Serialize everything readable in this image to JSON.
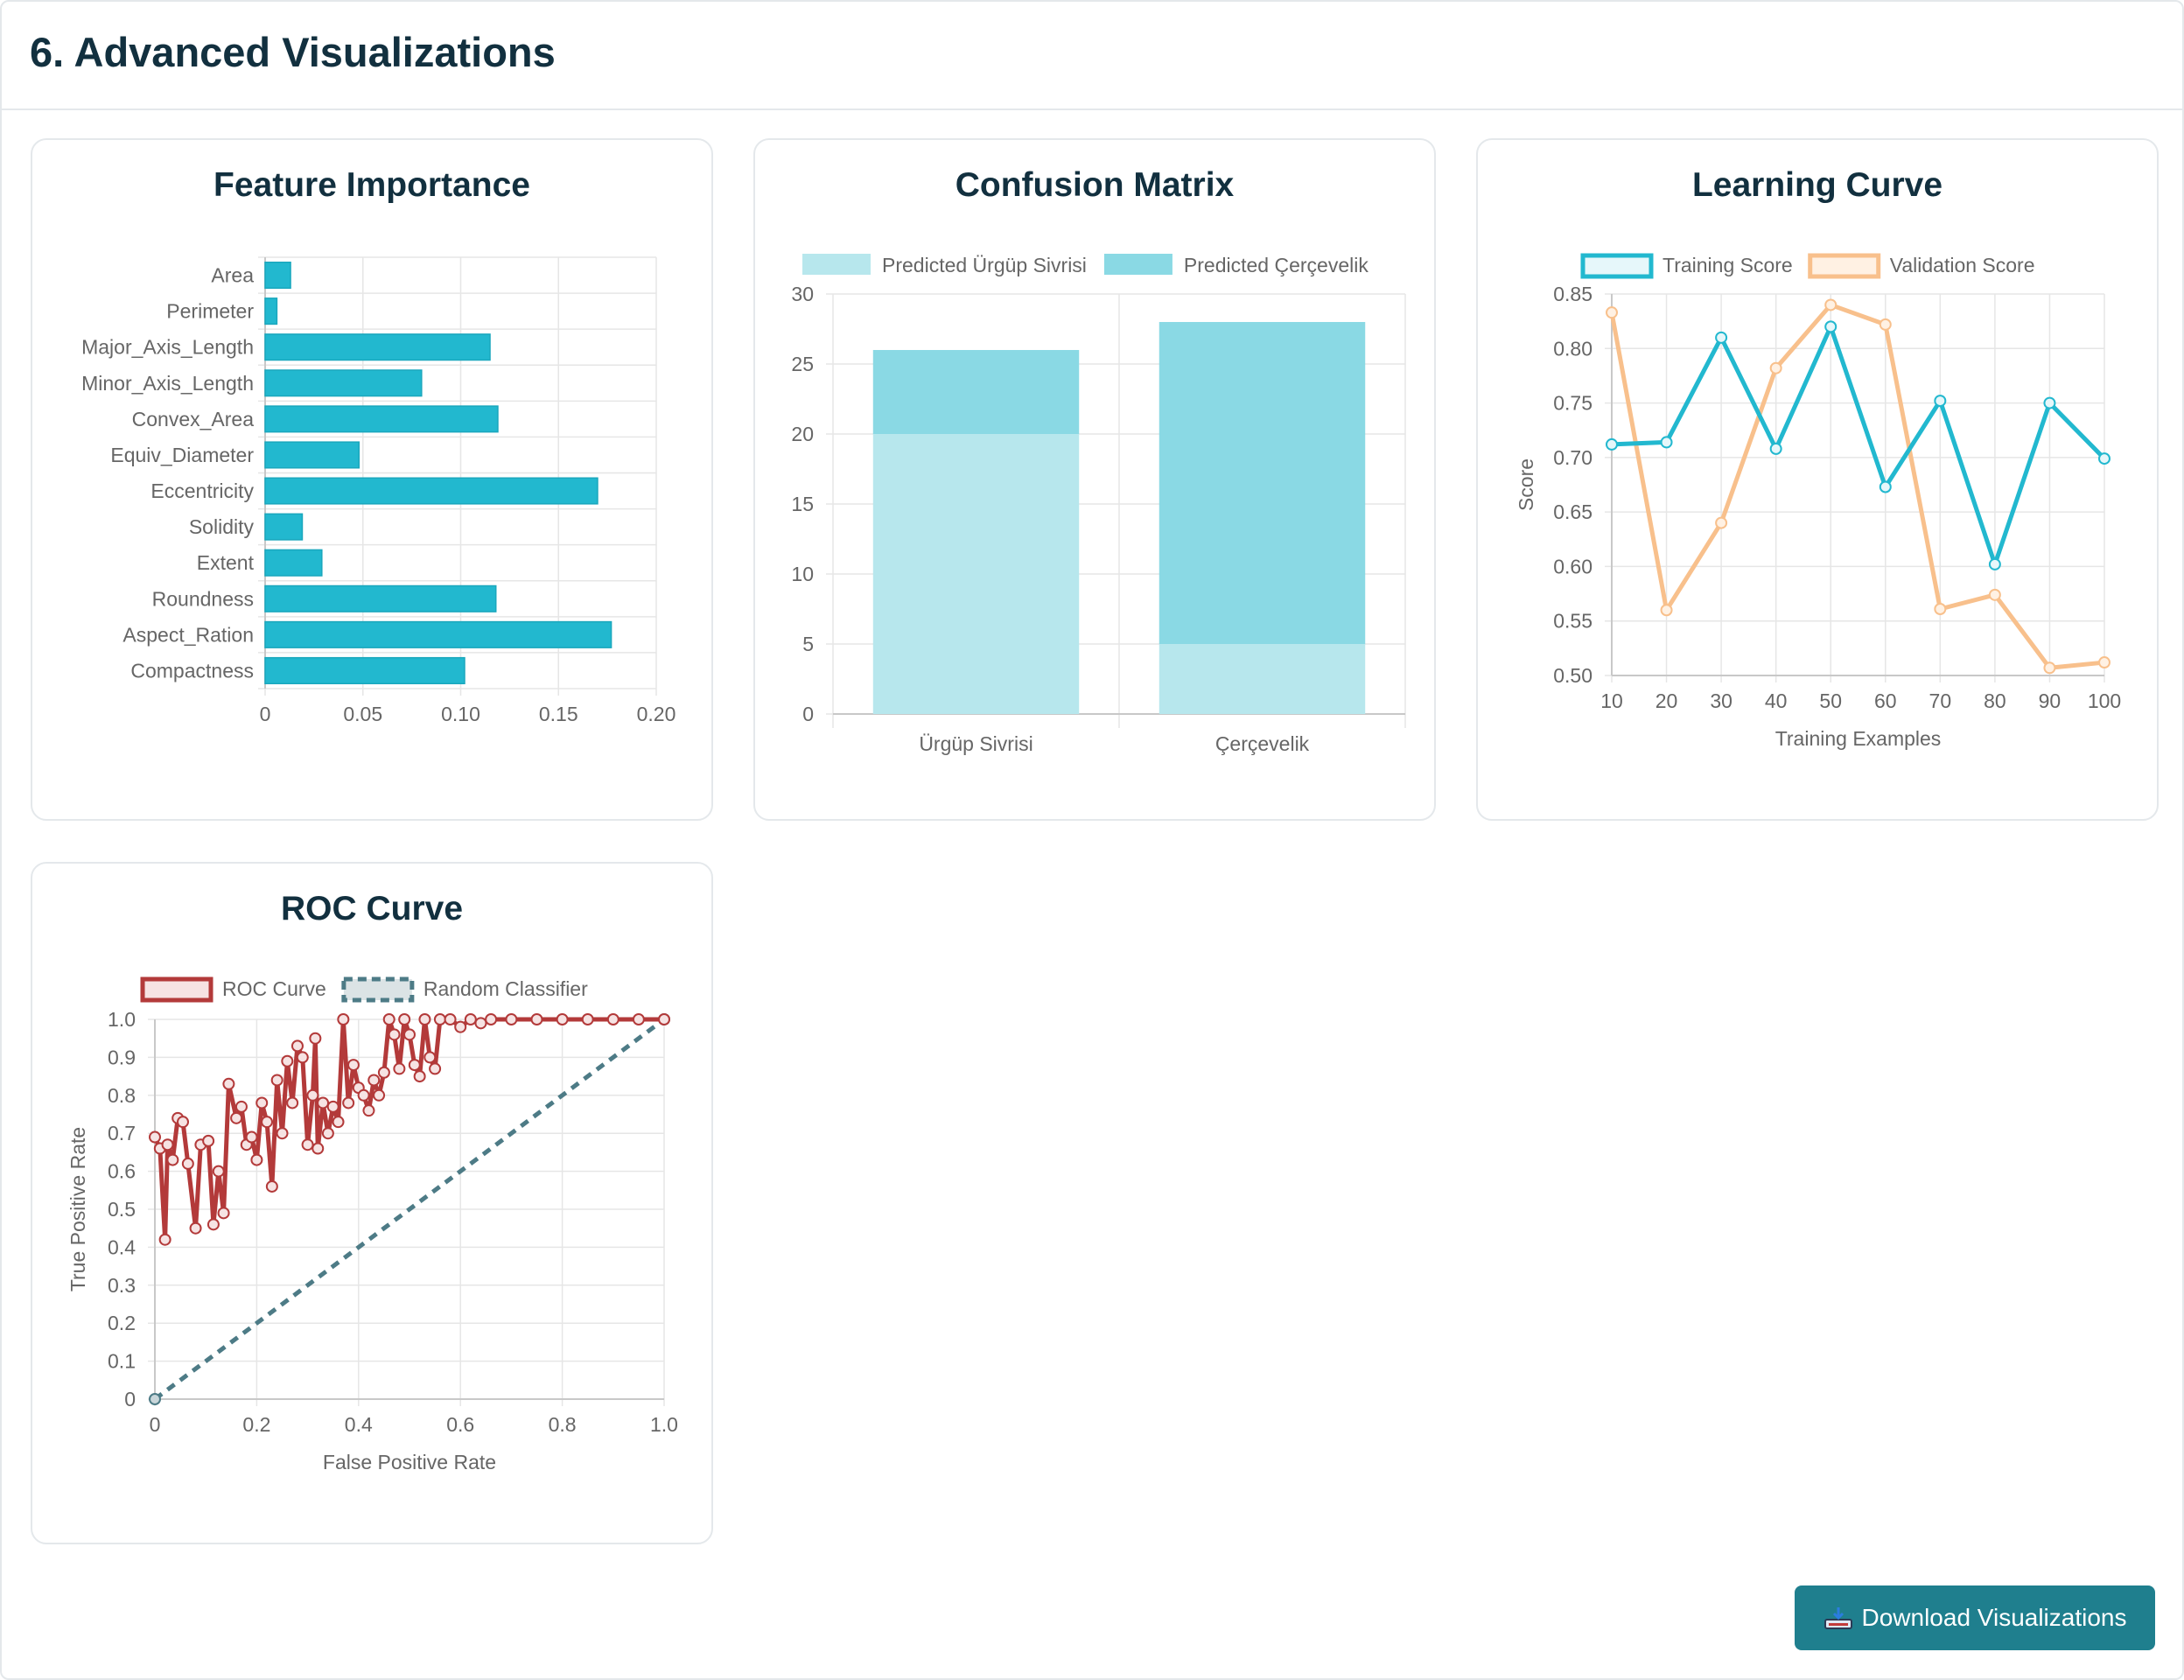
{
  "section": {
    "title": "6. Advanced Visualizations"
  },
  "download": {
    "label": "Download Visualizations",
    "icon": "download-icon"
  },
  "colors": {
    "teal": "#22b8cf",
    "teal_light": "#b7e7ed",
    "teal_mid": "#8ad9e4",
    "orange": "#f8c08c",
    "red": "#b33a3a",
    "slate": "#4d7b86",
    "button": "#1f7f8e"
  },
  "chart_data": [
    {
      "id": "feature_importance",
      "type": "bar",
      "orientation": "horizontal",
      "title": "Feature Importance",
      "categories": [
        "Area",
        "Perimeter",
        "Major_Axis_Length",
        "Minor_Axis_Length",
        "Convex_Area",
        "Equiv_Diameter",
        "Eccentricity",
        "Solidity",
        "Extent",
        "Roundness",
        "Aspect_Ration",
        "Compactness"
      ],
      "values": [
        0.013,
        0.006,
        0.115,
        0.08,
        0.119,
        0.048,
        0.17,
        0.019,
        0.029,
        0.118,
        0.177,
        0.102
      ],
      "xlim": [
        0,
        0.2
      ],
      "xticks": [
        "0",
        "0.05",
        "0.10",
        "0.15",
        "0.20"
      ],
      "grid": true
    },
    {
      "id": "confusion_matrix",
      "type": "bar",
      "stacked": true,
      "title": "Confusion Matrix",
      "categories": [
        "Ürgüp Sivrisi",
        "Çerçevelik"
      ],
      "series": [
        {
          "name": "Predicted Ürgüp Sivrisi",
          "values": [
            20,
            5
          ]
        },
        {
          "name": "Predicted Çerçevelik",
          "values": [
            6,
            23
          ]
        }
      ],
      "ylim": [
        0,
        30
      ],
      "yticks": [
        "0",
        "5",
        "10",
        "15",
        "20",
        "25",
        "30"
      ],
      "legend": "top",
      "grid": true
    },
    {
      "id": "learning_curve",
      "type": "line",
      "title": "Learning Curve",
      "xlabel": "Training Examples",
      "ylabel": "Score",
      "x": [
        10,
        20,
        30,
        40,
        50,
        60,
        70,
        80,
        90,
        100
      ],
      "series": [
        {
          "name": "Training Score",
          "values": [
            0.712,
            0.714,
            0.81,
            0.708,
            0.82,
            0.673,
            0.752,
            0.602,
            0.75,
            0.699
          ]
        },
        {
          "name": "Validation Score",
          "values": [
            0.833,
            0.56,
            0.64,
            0.782,
            0.84,
            0.822,
            0.561,
            0.574,
            0.507,
            0.512
          ]
        }
      ],
      "ylim": [
        0.5,
        0.85
      ],
      "yticks": [
        "0.50",
        "0.55",
        "0.60",
        "0.65",
        "0.70",
        "0.75",
        "0.80",
        "0.85"
      ],
      "xticks": [
        "10",
        "20",
        "30",
        "40",
        "50",
        "60",
        "70",
        "80",
        "90",
        "100"
      ],
      "legend": "top",
      "grid": true
    },
    {
      "id": "roc_curve",
      "type": "line",
      "title": "ROC Curve",
      "xlabel": "False Positive Rate",
      "ylabel": "True Positive Rate",
      "series": [
        {
          "name": "ROC Curve",
          "points": [
            [
              0,
              0.69
            ],
            [
              0.01,
              0.66
            ],
            [
              0.02,
              0.42
            ],
            [
              0.025,
              0.67
            ],
            [
              0.035,
              0.63
            ],
            [
              0.045,
              0.74
            ],
            [
              0.055,
              0.73
            ],
            [
              0.065,
              0.62
            ],
            [
              0.08,
              0.45
            ],
            [
              0.09,
              0.67
            ],
            [
              0.105,
              0.68
            ],
            [
              0.115,
              0.46
            ],
            [
              0.125,
              0.6
            ],
            [
              0.135,
              0.49
            ],
            [
              0.145,
              0.83
            ],
            [
              0.16,
              0.74
            ],
            [
              0.17,
              0.77
            ],
            [
              0.18,
              0.67
            ],
            [
              0.19,
              0.69
            ],
            [
              0.2,
              0.63
            ],
            [
              0.21,
              0.78
            ],
            [
              0.22,
              0.73
            ],
            [
              0.23,
              0.56
            ],
            [
              0.24,
              0.84
            ],
            [
              0.25,
              0.7
            ],
            [
              0.26,
              0.89
            ],
            [
              0.27,
              0.78
            ],
            [
              0.28,
              0.93
            ],
            [
              0.29,
              0.9
            ],
            [
              0.3,
              0.67
            ],
            [
              0.31,
              0.8
            ],
            [
              0.315,
              0.95
            ],
            [
              0.32,
              0.66
            ],
            [
              0.33,
              0.78
            ],
            [
              0.34,
              0.7
            ],
            [
              0.35,
              0.77
            ],
            [
              0.36,
              0.73
            ],
            [
              0.37,
              1.0
            ],
            [
              0.38,
              0.78
            ],
            [
              0.39,
              0.88
            ],
            [
              0.4,
              0.82
            ],
            [
              0.41,
              0.8
            ],
            [
              0.42,
              0.76
            ],
            [
              0.43,
              0.84
            ],
            [
              0.44,
              0.8
            ],
            [
              0.45,
              0.86
            ],
            [
              0.46,
              1.0
            ],
            [
              0.47,
              0.96
            ],
            [
              0.48,
              0.87
            ],
            [
              0.49,
              1.0
            ],
            [
              0.5,
              0.96
            ],
            [
              0.51,
              0.88
            ],
            [
              0.52,
              0.85
            ],
            [
              0.53,
              1.0
            ],
            [
              0.54,
              0.9
            ],
            [
              0.55,
              0.87
            ],
            [
              0.56,
              1.0
            ],
            [
              0.58,
              1.0
            ],
            [
              0.6,
              0.98
            ],
            [
              0.62,
              1.0
            ],
            [
              0.64,
              0.99
            ],
            [
              0.66,
              1.0
            ],
            [
              0.7,
              1.0
            ],
            [
              0.75,
              1.0
            ],
            [
              0.8,
              1.0
            ],
            [
              0.85,
              1.0
            ],
            [
              0.9,
              1.0
            ],
            [
              0.95,
              1.0
            ],
            [
              1.0,
              1.0
            ]
          ]
        },
        {
          "name": "Random Classifier",
          "points": [
            [
              0,
              0
            ],
            [
              1,
              1
            ]
          ]
        }
      ],
      "xlim": [
        0,
        1
      ],
      "ylim": [
        0,
        1
      ],
      "xticks": [
        "0",
        "0.2",
        "0.4",
        "0.6",
        "0.8",
        "1.0"
      ],
      "yticks": [
        "0",
        "0.1",
        "0.2",
        "0.3",
        "0.4",
        "0.5",
        "0.6",
        "0.7",
        "0.8",
        "0.9",
        "1.0"
      ],
      "legend": "top",
      "grid": true
    }
  ]
}
